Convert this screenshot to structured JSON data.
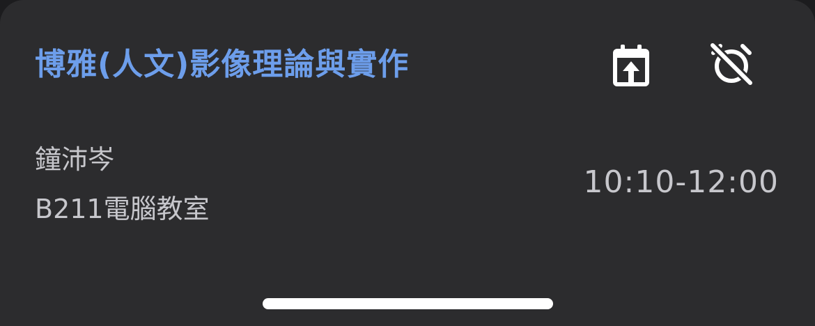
{
  "course": {
    "title": "博雅(人文)影像理論與實作",
    "title_color": "#6d9eeb",
    "teacher": "鐘沛岑",
    "room": "B211電腦教室",
    "time": "10:10-12:00"
  },
  "actions": {
    "calendar_icon": "calendar-upload-icon",
    "alarm_icon": "alarm-off-icon"
  },
  "colors": {
    "card_background": "#2c2c2e",
    "secondary_text": "#c7c7cc",
    "icon": "#ffffff"
  }
}
